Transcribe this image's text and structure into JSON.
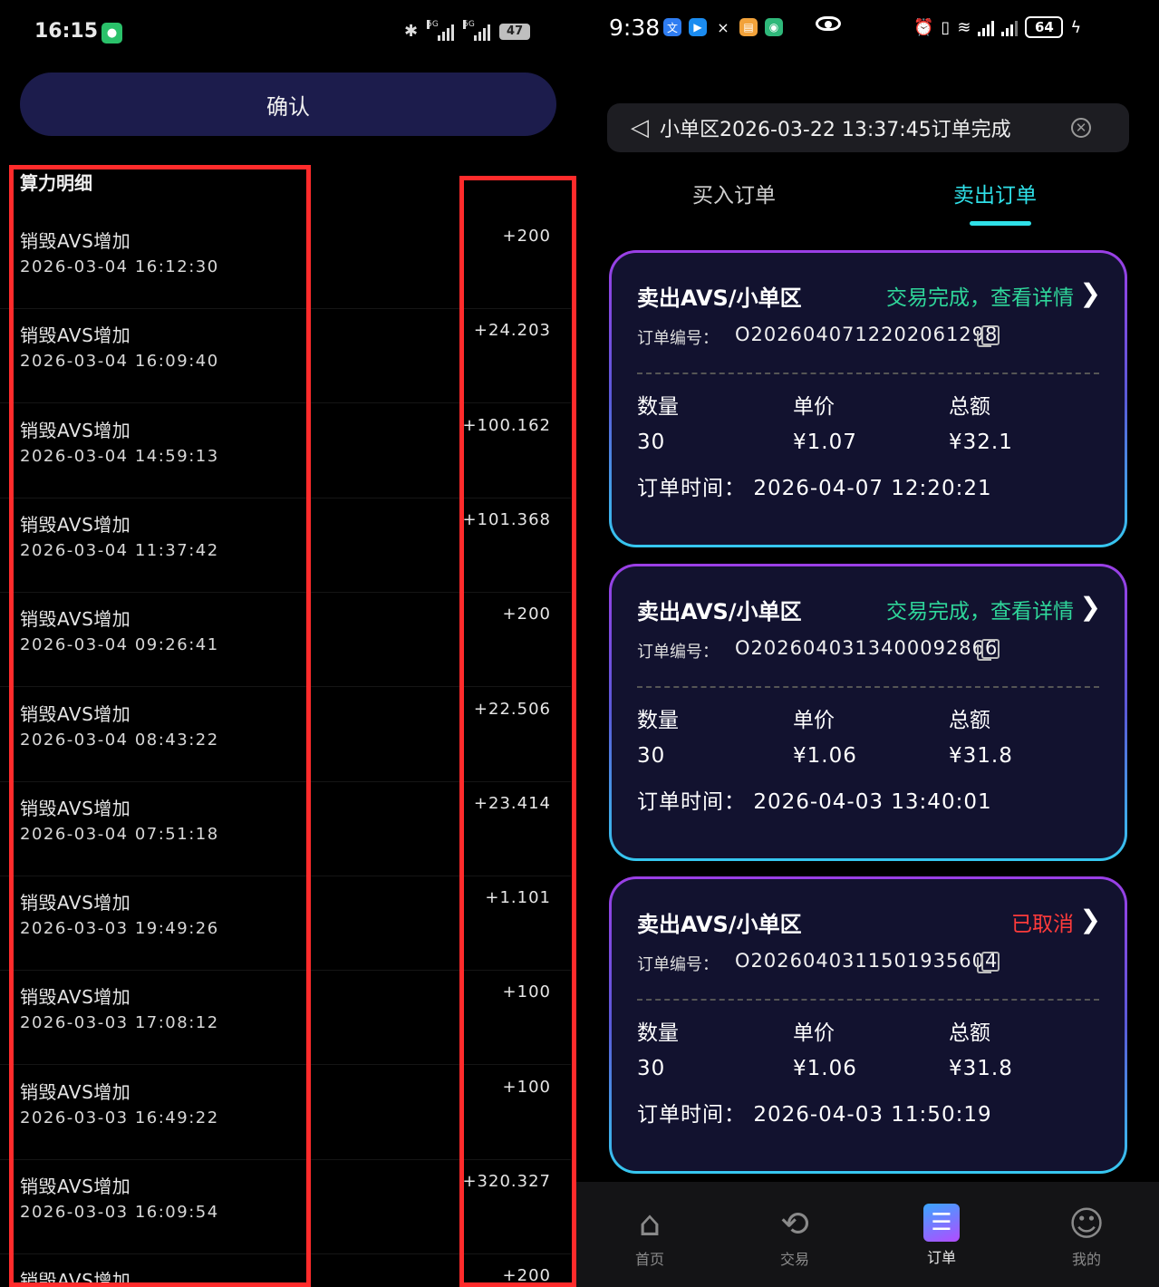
{
  "left": {
    "status_bar": {
      "time": "16:15",
      "network_1": "5G",
      "network_2": "5G",
      "battery": "47"
    },
    "confirm_label": "确认",
    "section_title": "算力明细",
    "records": [
      {
        "title": "销毁AVS增加",
        "time": "2026-03-04 16:12:30",
        "amount": "+200"
      },
      {
        "title": "销毁AVS增加",
        "time": "2026-03-04 16:09:40",
        "amount": "+24.203"
      },
      {
        "title": "销毁AVS增加",
        "time": "2026-03-04 14:59:13",
        "amount": "+100.162"
      },
      {
        "title": "销毁AVS增加",
        "time": "2026-03-04 11:37:42",
        "amount": "+101.368"
      },
      {
        "title": "销毁AVS增加",
        "time": "2026-03-04 09:26:41",
        "amount": "+200"
      },
      {
        "title": "销毁AVS增加",
        "time": "2026-03-04 08:43:22",
        "amount": "+22.506"
      },
      {
        "title": "销毁AVS增加",
        "time": "2026-03-04 07:51:18",
        "amount": "+23.414"
      },
      {
        "title": "销毁AVS增加",
        "time": "2026-03-03 19:49:26",
        "amount": "+1.101"
      },
      {
        "title": "销毁AVS增加",
        "time": "2026-03-03 17:08:12",
        "amount": "+100"
      },
      {
        "title": "销毁AVS增加",
        "time": "2026-03-03 16:49:22",
        "amount": "+100"
      },
      {
        "title": "销毁AVS增加",
        "time": "2026-03-03 16:09:54",
        "amount": "+320.327"
      },
      {
        "title": "销毁AVS增加",
        "time": "",
        "amount": "+200"
      }
    ],
    "highlight_color": "#ff2b2b"
  },
  "right": {
    "status_bar": {
      "time": "9:38",
      "battery": "64"
    },
    "notice": "小单区2026-03-22 13:37:45订单完成",
    "tabs": {
      "buy": "买入订单",
      "sell": "卖出订单"
    },
    "accent_color": "#2fe0e8",
    "orders": [
      {
        "title": "卖出AVS/小单区",
        "status": "交易完成，查看详情",
        "status_color": "#2fd69a",
        "order_label": "订单编号：",
        "order_no": "O2026040712202061298",
        "qty_label": "数量",
        "price_label": "单价",
        "total_label": "总额",
        "qty": "30",
        "price": "¥1.07",
        "total": "¥32.1",
        "time_label": "订单时间：",
        "time": "2026-04-07 12:20:21"
      },
      {
        "title": "卖出AVS/小单区",
        "status": "交易完成，查看详情",
        "status_color": "#2fd69a",
        "order_label": "订单编号：",
        "order_no": "O2026040313400092866",
        "qty_label": "数量",
        "price_label": "单价",
        "total_label": "总额",
        "qty": "30",
        "price": "¥1.06",
        "total": "¥31.8",
        "time_label": "订单时间：",
        "time": "2026-04-03 13:40:01"
      },
      {
        "title": "卖出AVS/小单区",
        "status": "已取消",
        "status_color": "#ff3b3b",
        "order_label": "订单编号：",
        "order_no": "O2026040311501935604",
        "qty_label": "数量",
        "price_label": "单价",
        "total_label": "总额",
        "qty": "30",
        "price": "¥1.06",
        "total": "¥31.8",
        "time_label": "订单时间：",
        "time": "2026-04-03 11:50:19"
      }
    ],
    "nav": [
      {
        "label": "首页",
        "icon": "home-icon"
      },
      {
        "label": "交易",
        "icon": "trade-icon"
      },
      {
        "label": "订单",
        "icon": "orders-icon"
      },
      {
        "label": "我的",
        "icon": "profile-icon"
      }
    ]
  }
}
